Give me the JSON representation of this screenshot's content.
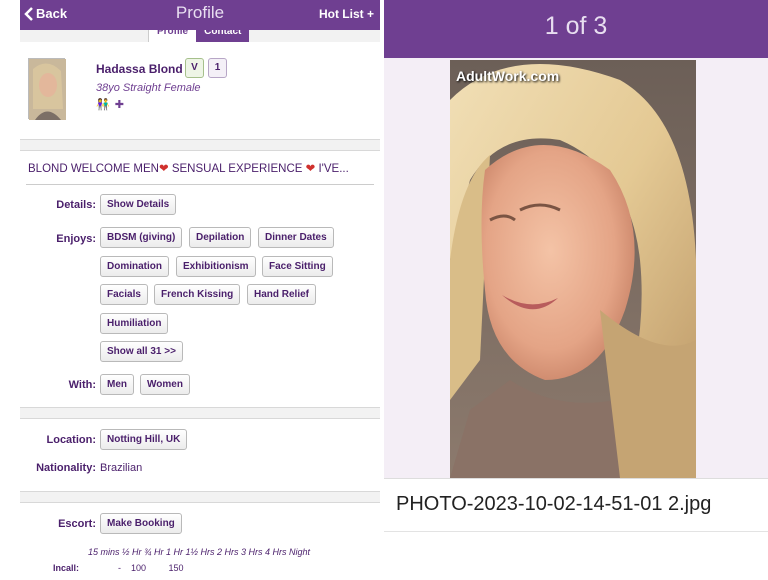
{
  "header": {
    "back_label": "Back",
    "title": "Profile",
    "hotlist_label": "Hot List +"
  },
  "tabs": [
    {
      "label": "Profile"
    },
    {
      "label": "Contact"
    }
  ],
  "profile": {
    "name": "Hadassa Blond",
    "badge_verified": "V",
    "badge_count": "1",
    "subtitle": "38yo Straight Female",
    "icons": "🚻 🏍"
  },
  "headline": {
    "text": "BLOND WELCOME MEN",
    "mid": " SENSUAL EXPERIENCE ",
    "end": " I'VE..."
  },
  "details": {
    "label": "Details:",
    "button": "Show Details"
  },
  "enjoys": {
    "label": "Enjoys:",
    "items": [
      "BDSM (giving)",
      "Depilation",
      "Dinner Dates",
      "Domination",
      "Exhibitionism",
      "Face Sitting",
      "Facials",
      "French Kissing",
      "Hand Relief",
      "Humiliation"
    ],
    "show_all": "Show all 31 >>"
  },
  "with": {
    "label": "With:",
    "items": [
      "Men",
      "Women"
    ]
  },
  "location": {
    "label": "Location:",
    "value": "Notting Hill, UK"
  },
  "nationality": {
    "label": "Nationality:",
    "value": "Brazilian"
  },
  "escort": {
    "label": "Escort:",
    "button": "Make Booking"
  },
  "rates": {
    "headers": "15 mins  ½ Hr  ¾ Hr  1 Hr  1½ Hrs  2 Hrs  3 Hrs  4 Hrs  Night",
    "incall_label": "Incall:",
    "incall_values": "-    100         150"
  },
  "viewer": {
    "counter": "1 of 3",
    "watermark": "AdultWork.com",
    "filename": "PHOTO-2023-10-02-14-51-01 2.jpg"
  },
  "colors": {
    "brand": "#6f3f91",
    "text": "#4a1f6b",
    "heart": "#d0312d"
  }
}
